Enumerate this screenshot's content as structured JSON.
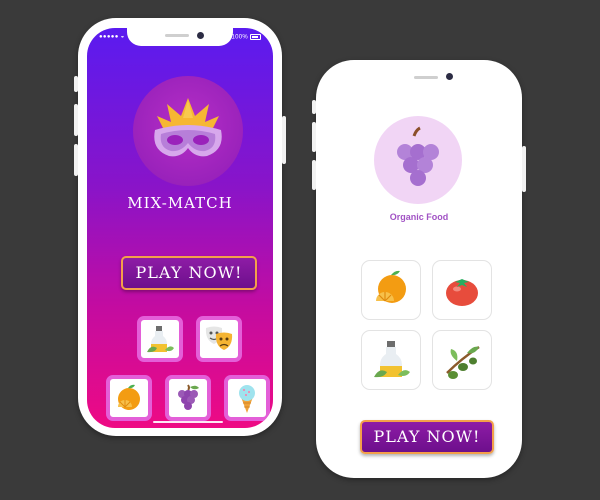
{
  "left_screen": {
    "status_left": "●●●●● ◒",
    "status_right": "100%",
    "app_title": "MIX-MATCH",
    "play_button": "PLAY NOW!",
    "logo_icon": "mask-icon",
    "tiles": [
      "oil-bottle-icon",
      "theater-masks-icon",
      "orange-icon",
      "grapes-icon",
      "ice-cream-icon"
    ]
  },
  "right_screen": {
    "category_icon": "grapes-icon",
    "category_label": "Organic Food",
    "play_button": "PLAY NOW!",
    "tiles": [
      "orange-icon",
      "tomato-icon",
      "oil-bottle-icon",
      "olive-branch-icon"
    ]
  },
  "colors": {
    "background": "#3a3a3a",
    "gradient_top": "#5a1bf0",
    "gradient_bottom": "#ee0a84",
    "button": "#7a1596",
    "button_border": "#f3a04a",
    "tile_border_pink": "#e35fd8",
    "organic_label": "#a152c4"
  }
}
